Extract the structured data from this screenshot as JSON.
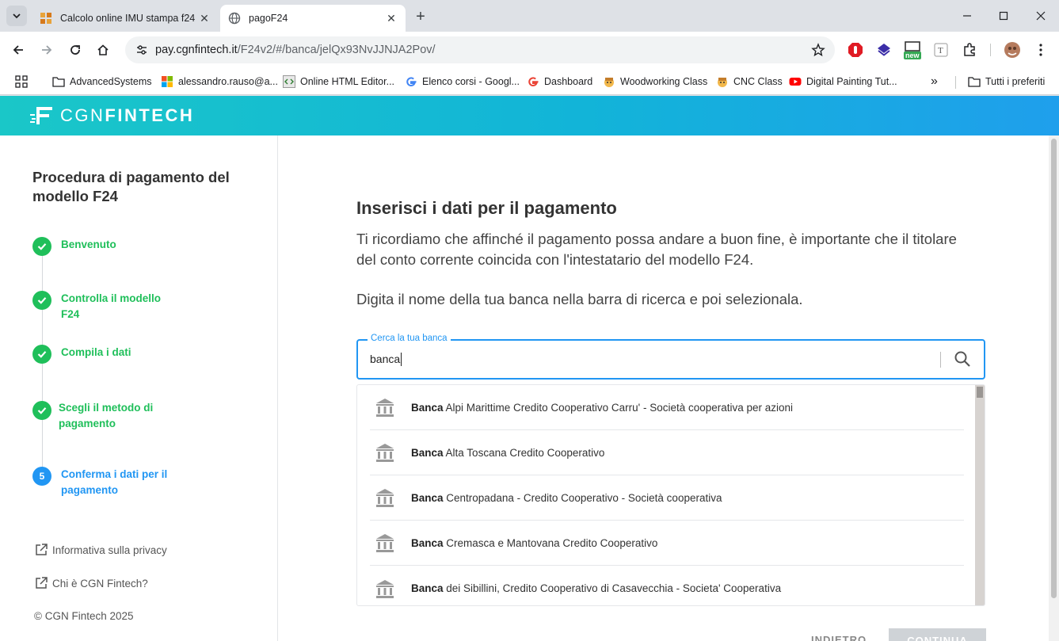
{
  "browser": {
    "tabs": [
      {
        "title": "Calcolo online IMU stampa f24",
        "active": false,
        "favicon": "orange-grid-icon"
      },
      {
        "title": "pagoF24",
        "active": true,
        "favicon": "globe-icon"
      }
    ],
    "address": {
      "host": "pay.cgnfintech.it",
      "path": "/F24v2/#/banca/jelQx93NvJJNJA2Pov/"
    },
    "extension_badge": "new",
    "bookmarks": [
      {
        "label": "AdvancedSystems",
        "icon": "folder-icon"
      },
      {
        "label": "alessandro.rauso@a...",
        "icon": "microsoft-icon"
      },
      {
        "label": "Online HTML Editor...",
        "icon": "code-icon"
      },
      {
        "label": "Elenco corsi - Googl...",
        "icon": "google-icon"
      },
      {
        "label": "Dashboard",
        "icon": "google-icon"
      },
      {
        "label": "Woodworking Class",
        "icon": "avatar-icon"
      },
      {
        "label": "CNC Class",
        "icon": "avatar-icon"
      },
      {
        "label": "Digital Painting Tut...",
        "icon": "youtube-icon"
      }
    ],
    "bookmarks_overflow": "»",
    "all_bookmarks": "Tutti i preferiti"
  },
  "brand": {
    "light": "CGN",
    "bold": "FINTECH"
  },
  "sidebar": {
    "title": "Procedura di pagamento del modello F24",
    "steps": [
      {
        "label": "Benvenuto",
        "done": true
      },
      {
        "label": "Controlla il modello F24",
        "done": true
      },
      {
        "label": "Compila i dati",
        "done": true
      },
      {
        "label": "Scegli il metodo di pagamento",
        "done": true
      },
      {
        "label": "Conferma i dati per il pagamento",
        "done": false,
        "number": "5"
      }
    ],
    "links": [
      "Informativa sulla privacy",
      "Chi è CGN Fintech?"
    ],
    "copyright": "© CGN Fintech 2025"
  },
  "main": {
    "title": "Inserisci i dati per il pagamento",
    "paragraph1": "Ti ricordiamo che affinché il pagamento possa andare a buon fine, è importante che il titolare del conto corrente coincida con l'intestatario del modello F24.",
    "paragraph2": "Digita il nome della tua banca nella barra di ricerca e poi selezionala.",
    "search": {
      "label": "Cerca la tua banca",
      "value": "banca"
    },
    "results": [
      {
        "bold": "Banca",
        "rest": " Alpi Marittime Credito Cooperativo Carru' - Società cooperativa per azioni"
      },
      {
        "bold": "Banca",
        "rest": " Alta Toscana Credito Cooperativo"
      },
      {
        "bold": "Banca",
        "rest": " Centropadana - Credito Cooperativo - Società cooperativa"
      },
      {
        "bold": "Banca",
        "rest": " Cremasca e Mantovana Credito Cooperativo"
      },
      {
        "bold": "Banca",
        "rest": " dei Sibillini, Credito Cooperativo di Casavecchia - Societa' Cooperativa"
      }
    ],
    "back_label": "INDIETRO",
    "next_label": "CONTINUA"
  },
  "colors": {
    "accent": "#2196f3",
    "success": "#1fbf5a",
    "brand_start": "#1ac7c8",
    "brand_end": "#1f9fec"
  }
}
